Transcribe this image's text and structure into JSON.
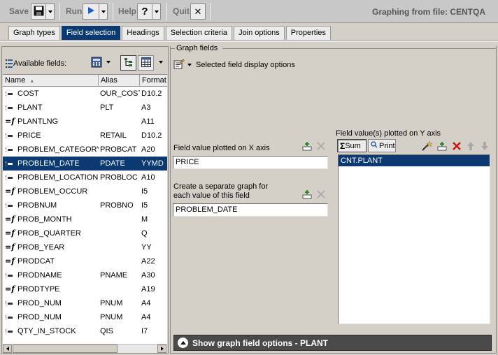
{
  "toolbar": {
    "save_label": "Save",
    "run_label": "Run",
    "help_label": "Help",
    "help_glyph": "?",
    "quit_label": "Quit",
    "quit_glyph": "✕",
    "window_title": "Graphing from file: CENTQA"
  },
  "tabs": [
    {
      "label": "Graph types",
      "active": false
    },
    {
      "label": "Field selection",
      "active": true
    },
    {
      "label": "Headings",
      "active": false
    },
    {
      "label": "Selection criteria",
      "active": false
    },
    {
      "label": "Join options",
      "active": false
    },
    {
      "label": "Properties",
      "active": false
    }
  ],
  "available_fields": {
    "title": "Available fields:",
    "columns": [
      "Name",
      "Alias",
      "Format"
    ],
    "sort_indicator": "▲",
    "rows": [
      {
        "icon": "field",
        "name": "COST",
        "alias": "OUR_COST",
        "format": "D10.2",
        "selected": false
      },
      {
        "icon": "field",
        "name": "PLANT",
        "alias": "PLT",
        "format": "A3",
        "selected": false
      },
      {
        "icon": "calc",
        "name": "PLANTLNG",
        "alias": "",
        "format": "A11",
        "selected": false
      },
      {
        "icon": "field",
        "name": "PRICE",
        "alias": "RETAIL",
        "format": "D10.2",
        "selected": false
      },
      {
        "icon": "field",
        "name": "PROBLEM_CATEGORY",
        "alias": "PROBCAT",
        "format": "A20",
        "selected": false
      },
      {
        "icon": "field",
        "name": "PROBLEM_DATE",
        "alias": "PDATE",
        "format": "YYMD",
        "selected": true
      },
      {
        "icon": "field",
        "name": "PROBLEM_LOCATION",
        "alias": "PROBLOC",
        "format": "A10",
        "selected": false
      },
      {
        "icon": "calc",
        "name": "PROBLEM_OCCUR",
        "alias": "",
        "format": "I5",
        "selected": false
      },
      {
        "icon": "field",
        "name": "PROBNUM",
        "alias": "PROBNO",
        "format": "I5",
        "selected": false
      },
      {
        "icon": "calc",
        "name": "PROB_MONTH",
        "alias": "",
        "format": "M",
        "selected": false
      },
      {
        "icon": "calc",
        "name": "PROB_QUARTER",
        "alias": "",
        "format": "Q",
        "selected": false
      },
      {
        "icon": "calc",
        "name": "PROB_YEAR",
        "alias": "",
        "format": "YY",
        "selected": false
      },
      {
        "icon": "calc",
        "name": "PRODCAT",
        "alias": "",
        "format": "A22",
        "selected": false
      },
      {
        "icon": "field",
        "name": "PRODNAME",
        "alias": "PNAME",
        "format": "A30",
        "selected": false
      },
      {
        "icon": "calc",
        "name": "PRODTYPE",
        "alias": "",
        "format": "A19",
        "selected": false
      },
      {
        "icon": "field",
        "name": "PROD_NUM",
        "alias": "PNUM",
        "format": "A4",
        "selected": false
      },
      {
        "icon": "field",
        "name": "PROD_NUM",
        "alias": "PNUM",
        "format": "A4",
        "selected": false
      },
      {
        "icon": "field",
        "name": "QTY_IN_STOCK",
        "alias": "QIS",
        "format": "I7",
        "selected": false
      }
    ]
  },
  "graph_fields": {
    "legend": "Graph fields",
    "display_options_label": "Selected field display options",
    "x_axis_label": "Field value plotted on X axis",
    "x_axis_value": "PRICE",
    "separate_graph_label_line1": "Create a separate graph for",
    "separate_graph_label_line2": "each value of this field",
    "separate_graph_value": "PROBLEM_DATE",
    "y_axis_label": "Field value(s) plotted on Y axis",
    "sum_label": "Sum",
    "sum_glyph": "Σ",
    "print_label": "Print",
    "y_axis_items": [
      "CNT.PLANT"
    ]
  },
  "footer": {
    "show_options_label": "Show graph field options - PLANT"
  },
  "colors": {
    "selection": "#0b3a73",
    "delete": "#d01010",
    "add": "#2a8a2a",
    "run_arrow": "#1a5fd0"
  }
}
